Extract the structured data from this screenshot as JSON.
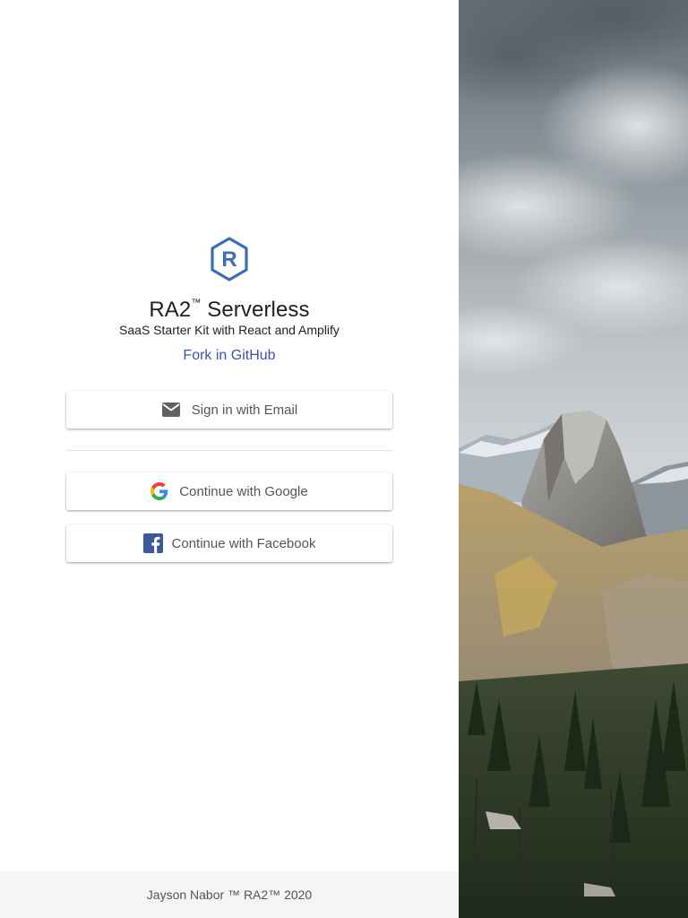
{
  "brand": {
    "logo_icon": "ra2-hexagon-logo-icon",
    "logo_letter": "R",
    "title": "RA2",
    "title_tm": "™",
    "title_rest": " Serverless",
    "subtitle": "SaaS Starter Kit with React and Amplify",
    "link_label": "Fork in GitHub",
    "accent_color": "#3f51b5",
    "logo_color": "#3a6fb7"
  },
  "auth": {
    "email_label": "Sign in with Email",
    "email_icon": "mail-icon",
    "google_label": "Continue with Google",
    "google_icon": "google-g-icon",
    "facebook_label": "Continue with Facebook",
    "facebook_icon": "facebook-icon",
    "facebook_color": "#3b5998"
  },
  "footer": {
    "text": "Jayson Nabor ™ RA2™ 2020"
  },
  "hero": {
    "image": "mountain-landscape-photo"
  }
}
